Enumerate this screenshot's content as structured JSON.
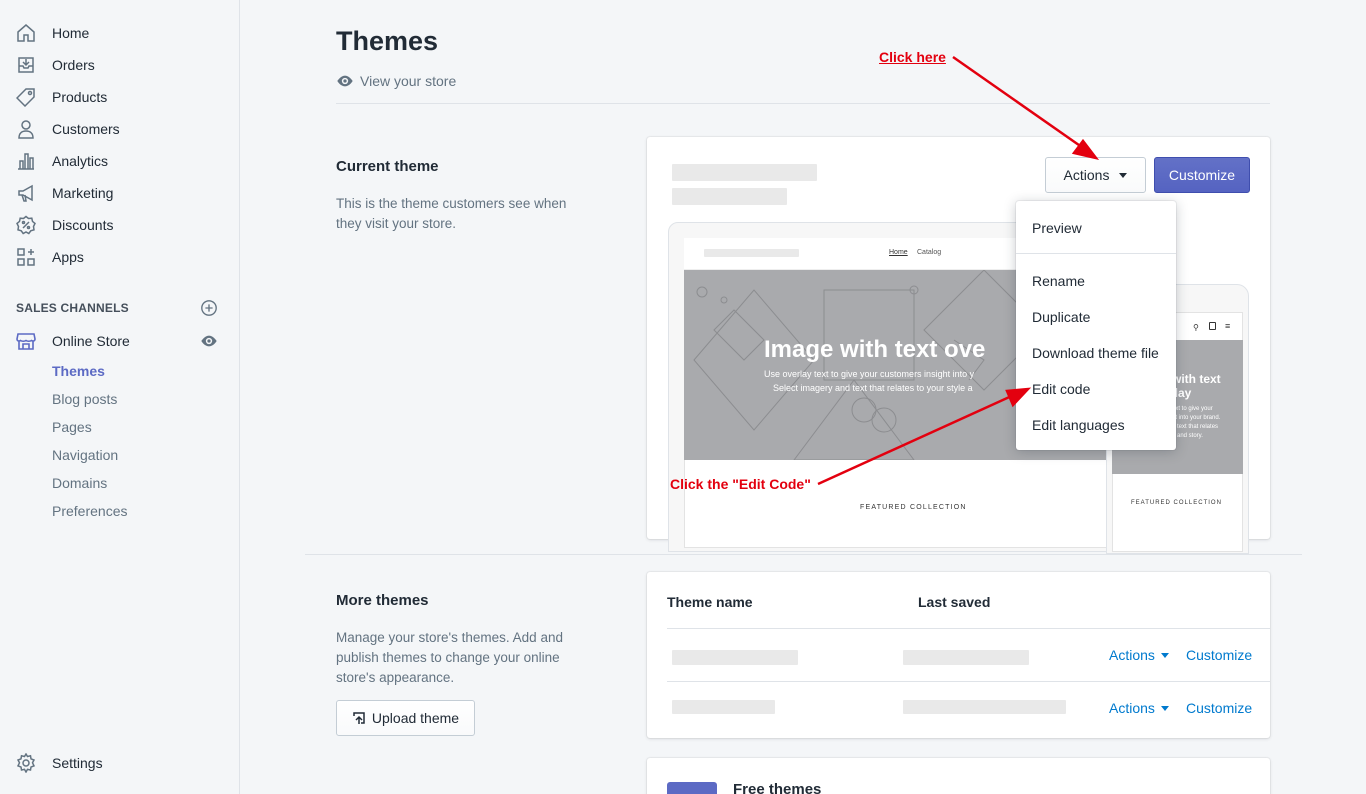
{
  "sidebar": {
    "items": [
      {
        "label": "Home",
        "icon": "home-icon"
      },
      {
        "label": "Orders",
        "icon": "orders-icon"
      },
      {
        "label": "Products",
        "icon": "tag-icon"
      },
      {
        "label": "Customers",
        "icon": "person-icon"
      },
      {
        "label": "Analytics",
        "icon": "bar-chart-icon"
      },
      {
        "label": "Marketing",
        "icon": "megaphone-icon"
      },
      {
        "label": "Discounts",
        "icon": "discount-icon"
      },
      {
        "label": "Apps",
        "icon": "apps-icon"
      }
    ],
    "sales_channels_label": "SALES CHANNELS",
    "online_store": "Online Store",
    "sub_items": [
      "Themes",
      "Blog posts",
      "Pages",
      "Navigation",
      "Domains",
      "Preferences"
    ],
    "settings": "Settings"
  },
  "header": {
    "title": "Themes",
    "view_store": "View your store"
  },
  "current_theme": {
    "title": "Current theme",
    "description": "This is the theme customers see when they visit your store.",
    "actions_label": "Actions",
    "customize_label": "Customize",
    "preview": {
      "nav_home": "Home",
      "nav_catalog": "Catalog",
      "hero_title": "Image with text ove",
      "hero_sub1": "Use overlay text to give your customers insight into y",
      "hero_sub2": "Select imagery and text that relates to your style a",
      "featured": "FEATURED COLLECTION",
      "mobile_title1": "with text",
      "mobile_title2": "rlay",
      "mobile_lines": [
        "ext to give your",
        "nt into your brand.",
        "d text that relates",
        "e and story."
      ],
      "mobile_featured": "FEATURED COLLECTION"
    }
  },
  "dropdown": {
    "items": [
      "Preview",
      "Rename",
      "Duplicate",
      "Download theme file",
      "Edit code",
      "Edit languages"
    ]
  },
  "annotations": {
    "click_here": "Click here",
    "click_edit_code": "Click the \"Edit Code\"",
    "color": "#e3000f"
  },
  "more_themes": {
    "title": "More themes",
    "description": "Manage your store's themes. Add and publish themes to change your online store's appearance.",
    "upload_label": "Upload theme",
    "col_theme_name": "Theme name",
    "col_last_saved": "Last saved",
    "rows": [
      {
        "actions": "Actions",
        "customize": "Customize"
      },
      {
        "actions": "Actions",
        "customize": "Customize"
      }
    ]
  },
  "free_themes": {
    "title": "Free themes"
  },
  "colors": {
    "accent": "#5c6ac4",
    "link": "#007ace",
    "text": "#212b36",
    "muted": "#637381"
  }
}
